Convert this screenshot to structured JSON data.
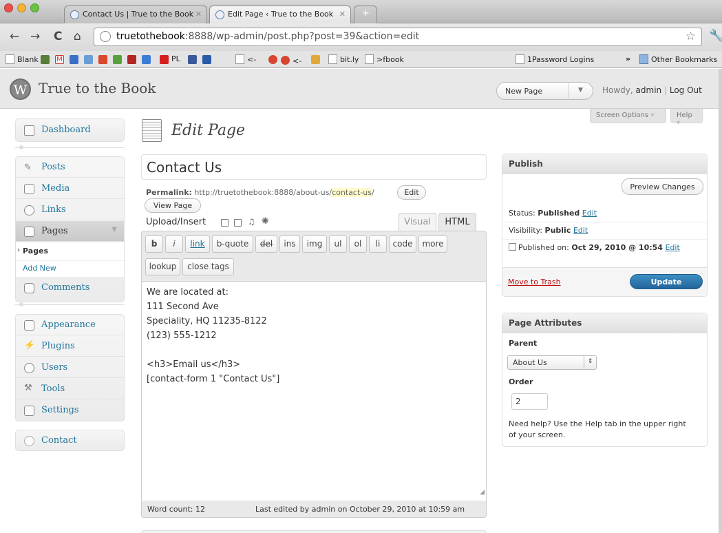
{
  "browser": {
    "tabs": [
      {
        "title": "Contact Us | True to the Book"
      },
      {
        "title": "Edit Page ‹ True to the Book"
      }
    ],
    "url_host": "truetothebook",
    "url_rest": ":8888/wp-admin/post.php?post=39&action=edit",
    "bookmarks": {
      "blank": "Blank",
      "pl": "PL",
      "back1": "<-",
      "back2": "<-",
      "bitly": "bit.ly",
      "fbook": ">fbook",
      "onepassword": "1Password Logins",
      "chevron": "»",
      "other": "Other Bookmarks"
    }
  },
  "header": {
    "site_title": "True to the Book",
    "favorite_action": "New Page",
    "howdy_prefix": "Howdy,",
    "user": "admin",
    "separator": "|",
    "logout": "Log Out",
    "screen_options": "Screen Options",
    "help": "Help"
  },
  "sidebar": {
    "dashboard": "Dashboard",
    "posts": "Posts",
    "media": "Media",
    "links": "Links",
    "pages": "Pages",
    "pages_sub": "Pages",
    "add_new": "Add New",
    "comments": "Comments",
    "appearance": "Appearance",
    "plugins": "Plugins",
    "users": "Users",
    "tools": "Tools",
    "settings": "Settings",
    "contact": "Contact"
  },
  "main": {
    "page_title": "Edit Page",
    "post_title": "Contact Us",
    "permalink_label": "Permalink:",
    "permalink_base": "http://truetothebook:8888/about-us/",
    "permalink_slug": "contact-us",
    "permalink_end": "/",
    "edit_btn": "Edit",
    "view_page": "View Page",
    "upload_insert": "Upload/Insert",
    "tab_visual": "Visual",
    "tab_html": "HTML",
    "quicktags": [
      "b",
      "i",
      "link",
      "b-quote",
      "del",
      "ins",
      "img",
      "ul",
      "ol",
      "li",
      "code",
      "more"
    ],
    "quicktags2": [
      "lookup",
      "close tags"
    ],
    "content_lines": [
      "We are located at:",
      "111 Second Ave",
      "Speciality, HQ 11235-8122",
      "(123) 555-1212",
      "",
      "<h3>Email us</h3>",
      "[contact-form 1 \"Contact Us\"]"
    ],
    "word_count": "Word count: 12",
    "last_edited": "Last edited by admin on October 29, 2010 at 10:59 am"
  },
  "publish": {
    "title": "Publish",
    "preview": "Preview Changes",
    "status_label": "Status:",
    "status_value": "Published",
    "visibility_label": "Visibility:",
    "visibility_value": "Public",
    "published_on_label": "Published on:",
    "published_on_value": "Oct 29, 2010 @ 10:54",
    "edit": "Edit",
    "trash": "Move to Trash",
    "update": "Update"
  },
  "attributes": {
    "title": "Page Attributes",
    "parent_label": "Parent",
    "parent_value": "About Us",
    "order_label": "Order",
    "order_value": "2",
    "help_line1": "Need help? Use the Help tab in the upper right",
    "help_line2": "of your screen."
  }
}
